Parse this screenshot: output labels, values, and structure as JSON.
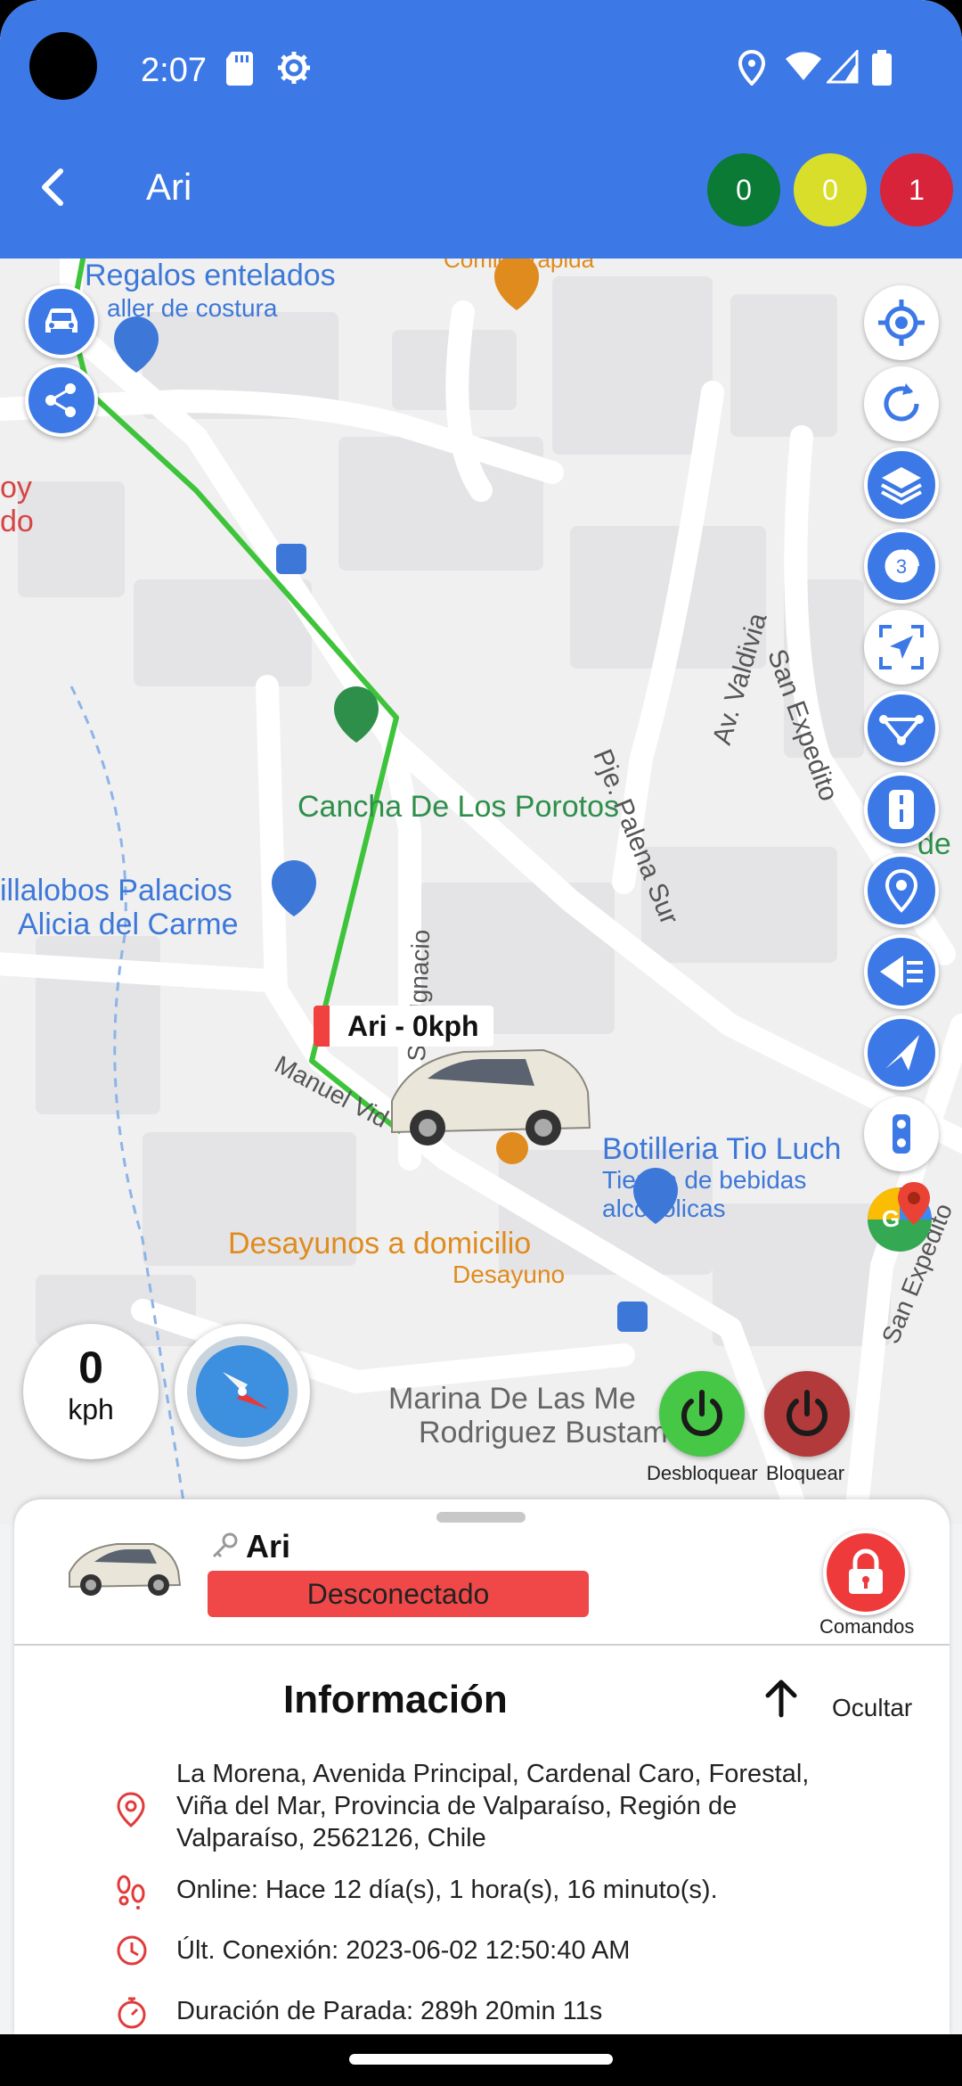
{
  "status_bar": {
    "time": "2:07"
  },
  "app_bar": {
    "title": "Ari",
    "counters": [
      {
        "value": "0",
        "color": "#0a7a35"
      },
      {
        "value": "0",
        "color": "#d9de2b"
      },
      {
        "value": "1",
        "color": "#d8243a"
      }
    ]
  },
  "map": {
    "labels": {
      "regalos": "Regalos entelados",
      "costura": "aller de costura",
      "comida": "Comida rápida",
      "toy1": "oy",
      "toy2": "do",
      "cancha": "Cancha De Los Porotos",
      "palena": "Pje. Palena Sur",
      "valdivia": "Av. Valdivia",
      "san_expedito": "San Expedito",
      "de": "de",
      "villalobos1": "illalobos Palacios",
      "villalobos2": "Alicia del Carme",
      "san_ignacio": "San Ignacio",
      "manuel": "Manuel Vid",
      "botilleria": "Botilleria Tio Luch",
      "tienda1": "Tienda de bebidas",
      "tienda2": "alcohólicas",
      "desayunos": "Desayunos a domicilio",
      "desayuno": "Desayuno",
      "san_expedito2": "San Expedito",
      "marina1": "Marina De Las Me",
      "marina2": "Rodriguez Bustamante"
    },
    "vehicle_marker": "Ari - 0kph",
    "speed": {
      "value": "0",
      "unit": "kph"
    },
    "layer_count": "3",
    "commands": {
      "unlock": "Desbloquear",
      "lock": "Bloquear"
    }
  },
  "sheet": {
    "vehicle_name": "Ari",
    "status": "Desconectado",
    "commands_label": "Comandos",
    "info_title": "Información",
    "hide_label": "Ocultar",
    "address": [
      "La Morena, Avenida Principal, Cardenal Caro, Forestal,",
      "Viña del Mar, Provincia de Valparaíso, Región de",
      "Valparaíso, 2562126, Chile"
    ],
    "online": "Online: Hace 12 día(s), 1 hora(s), 16 minuto(s).",
    "last_connection": "Últ. Conexión: 2023-06-02 12:50:40 AM",
    "stop_duration": "Duración de Parada: 289h 20min 11s"
  },
  "colors": {
    "primary": "#3c79e6",
    "route": "#3ec43a",
    "alert": "#f04848",
    "poi_green": "#2e8f4a",
    "poi_orange": "#e08b1d",
    "poi_blue": "#3d78d8"
  }
}
